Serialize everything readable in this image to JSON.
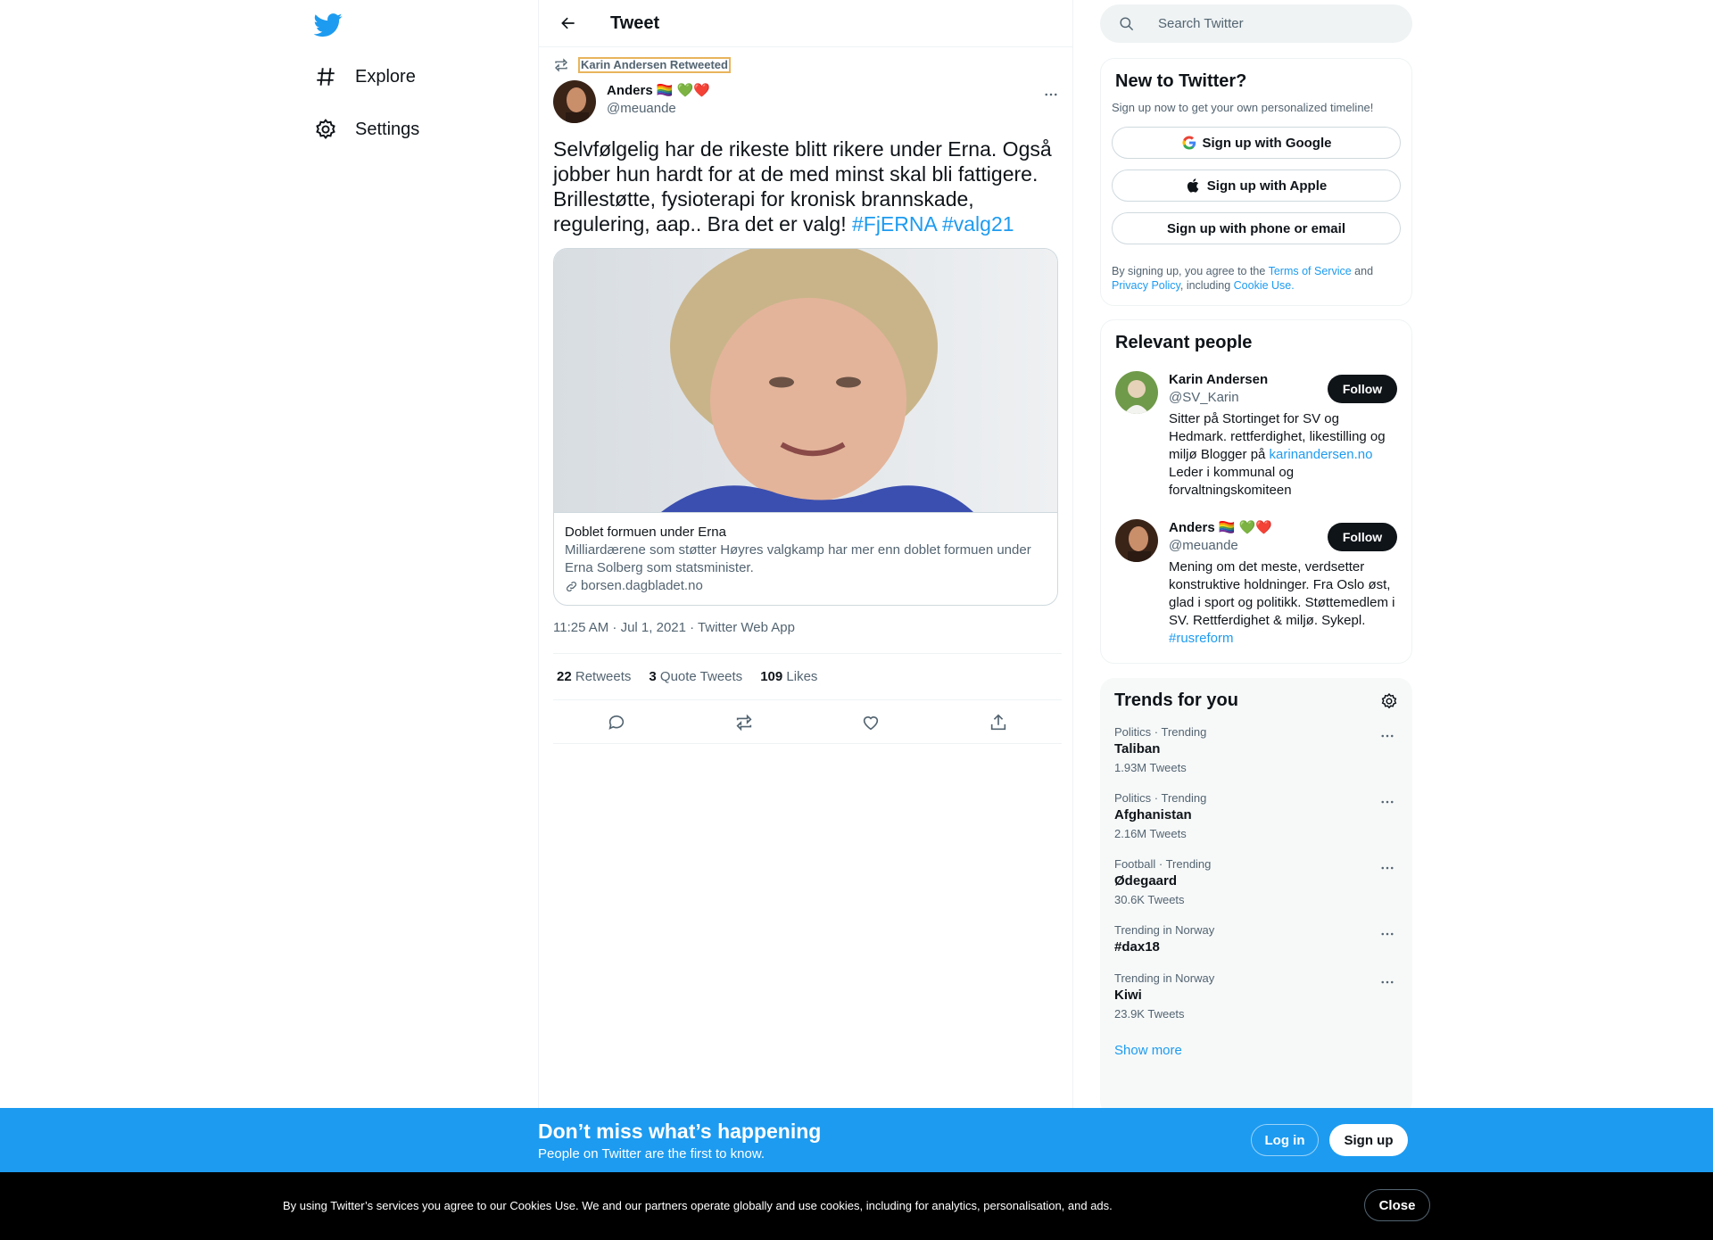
{
  "nav": {
    "logo": "twitter-bird-logo",
    "items": [
      {
        "label": "Explore",
        "icon": "hashtag-icon"
      },
      {
        "label": "Settings",
        "icon": "gear-icon"
      }
    ]
  },
  "header": {
    "title": "Tweet"
  },
  "tweet": {
    "retweeted_by": "Karin Andersen Retweeted",
    "author_name": "Anders 🏳️‍🌈 💚❤️",
    "author_handle": "@meuande",
    "text_main": "Selvfølgelig har de rikeste blitt rikere under Erna. Også jobber hun hardt for at de med minst skal bli fattigere. Brillestøtte, fysioterapi for kronisk brannskade, regulering, aap.. Bra det er valg! ",
    "hashtag1": "#FjERNA",
    "hashtag2": "#valg21",
    "card": {
      "title": "Doblet formuen under Erna",
      "description": "Milliardærene som støtter Høyres valgkamp har mer enn doblet formuen under Erna Solberg som statsminister.",
      "domain": "borsen.dagbladet.no"
    },
    "meta": "11:25 AM · Jul 1, 2021 · Twitter Web App",
    "stats": {
      "retweets_count": "22",
      "retweets_label": "Retweets",
      "quotes_count": "3",
      "quotes_label": "Quote Tweets",
      "likes_count": "109",
      "likes_label": "Likes"
    }
  },
  "search": {
    "placeholder": "Search Twitter"
  },
  "new_to_twitter": {
    "title": "New to Twitter?",
    "subtitle": "Sign up now to get your own personalized timeline!",
    "google_label": "Sign up with Google",
    "apple_label": "Sign up with Apple",
    "phone_label": "Sign up with phone or email",
    "terms_prefix": "By signing up, you agree to the ",
    "terms_link": "Terms of Service",
    "terms_and": " and ",
    "privacy_link": "Privacy Policy",
    "terms_including": ", including ",
    "cookie_link": "Cookie Use."
  },
  "relevant_people": {
    "title": "Relevant people",
    "people": [
      {
        "name": "Karin Andersen",
        "handle": "@SV_Karin",
        "bio_pre": "Sitter på Stortinget for SV og Hedmark. rettferdighet, likestilling og miljø Blogger på ",
        "bio_link": "karinandersen.no",
        "bio_post": " Leder i kommunal og forvaltningskomiteen",
        "follow_label": "Follow"
      },
      {
        "name": "Anders 🏳️‍🌈 💚❤️",
        "handle": "@meuande",
        "bio_pre": "Mening om det meste, verdsetter konstruktive holdninger. Fra Oslo øst, glad i sport og politikk. Støttemedlem i SV. Rettferdighet & miljø. Sykepl. ",
        "bio_link": "#rusreform",
        "bio_post": "",
        "follow_label": "Follow"
      }
    ]
  },
  "trends": {
    "title": "Trends for you",
    "items": [
      {
        "category": "Politics · Trending",
        "name": "Taliban",
        "count": "1.93M Tweets"
      },
      {
        "category": "Politics · Trending",
        "name": "Afghanistan",
        "count": "2.16M Tweets"
      },
      {
        "category": "Football · Trending",
        "name": "Ødegaard",
        "count": "30.6K Tweets"
      },
      {
        "category": "Trending in Norway",
        "name": "#dax18",
        "count": ""
      },
      {
        "category": "Trending in Norway",
        "name": "Kiwi",
        "count": "23.9K Tweets"
      }
    ],
    "show_more": "Show more"
  },
  "bottom_bar": {
    "title": "Don’t miss what’s happening",
    "subtitle": "People on Twitter are the first to know.",
    "login_label": "Log in",
    "signup_label": "Sign up"
  },
  "cookie_bar": {
    "text": "By using Twitter’s services you agree to our Cookies Use. We and our partners operate globally and use cookies, including for analytics, personalisation, and ads.",
    "close_label": "Close"
  },
  "colors": {
    "accent": "#1d9bf0",
    "text": "#0f1419",
    "secondary": "#536471",
    "border": "#eff3f4"
  }
}
